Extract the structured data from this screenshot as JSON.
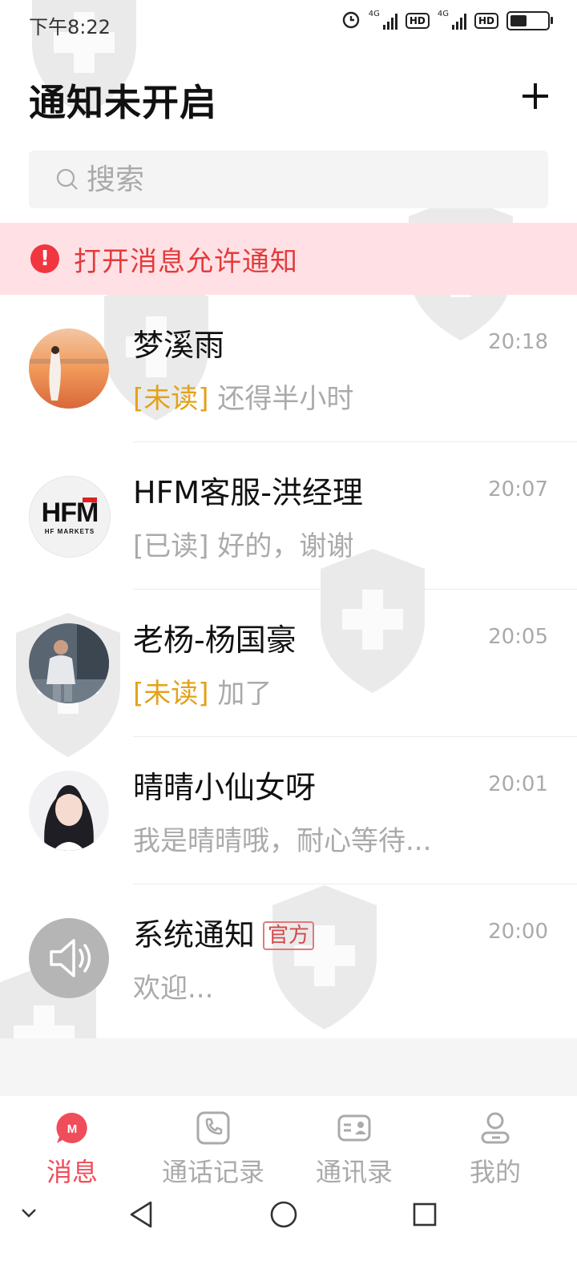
{
  "status_bar": {
    "time": "下午8:22",
    "network_1": "4G",
    "network_2": "4G",
    "hd_1": "HD",
    "hd_2": "HD",
    "battery_level": 0.45
  },
  "header": {
    "title": "通知未开启"
  },
  "search": {
    "placeholder": "搜索"
  },
  "notice": {
    "text": "打开消息允许通知",
    "icon_glyph": "!"
  },
  "chats": [
    {
      "name": "梦溪雨",
      "time": "20:18",
      "tag": "[未读]",
      "preview": "还得半小时"
    },
    {
      "name": "HFM客服-洪经理",
      "time": "20:07",
      "tag": "[已读]",
      "preview": "好的，谢谢",
      "avatar_text": "HFM",
      "avatar_subtext": "HF MARKETS"
    },
    {
      "name": "老杨-杨国豪",
      "time": "20:05",
      "tag": "[未读]",
      "preview": "加了"
    },
    {
      "name": "晴晴小仙女呀",
      "time": "20:01",
      "tag": "",
      "preview": "我是晴晴哦，耐心等待..."
    },
    {
      "name": "系统通知",
      "badge": "官方",
      "time": "20:00",
      "tag": "",
      "preview": "欢迎..."
    }
  ],
  "tabs": [
    {
      "label": "消息",
      "active": true,
      "icon": "message-icon"
    },
    {
      "label": "通话记录",
      "active": false,
      "icon": "call-log-icon"
    },
    {
      "label": "通讯录",
      "active": false,
      "icon": "contacts-icon"
    },
    {
      "label": "我的",
      "active": false,
      "icon": "profile-icon"
    }
  ],
  "colors": {
    "accent": "#f04d5a",
    "unread_tag": "#e3a21a",
    "notice_bg": "#ffe1e5",
    "notice_text": "#e33b3b"
  }
}
